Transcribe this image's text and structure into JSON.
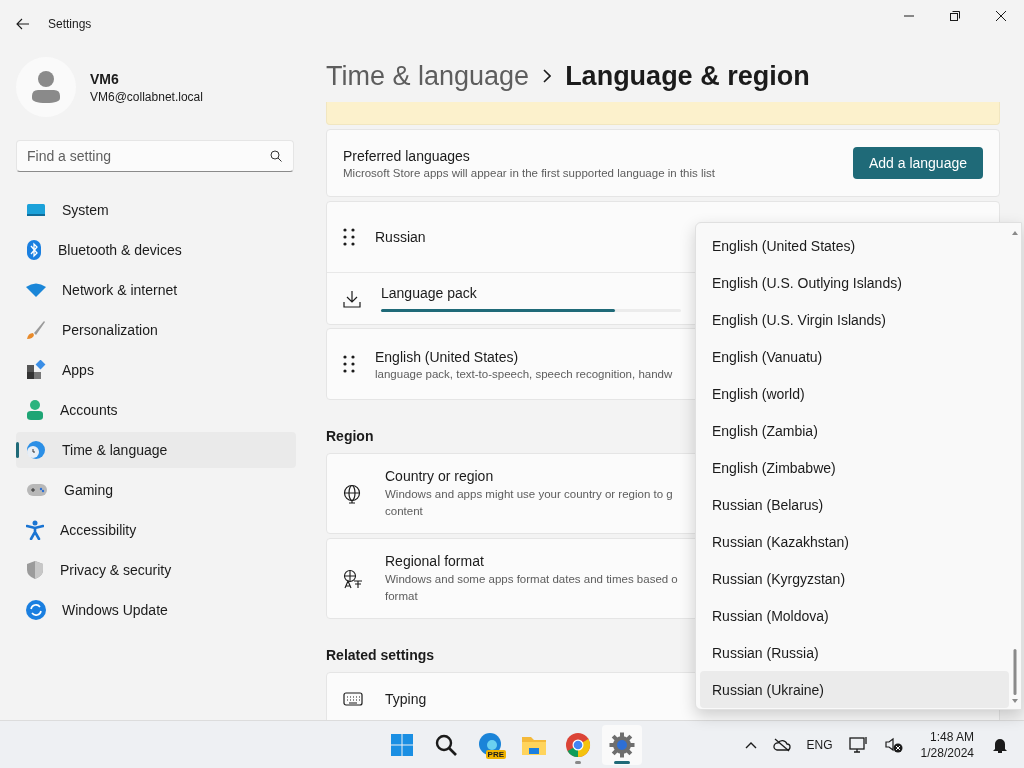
{
  "window": {
    "title": "Settings"
  },
  "account": {
    "name": "VM6",
    "email": "VM6@collabnet.local"
  },
  "search": {
    "placeholder": "Find a setting"
  },
  "sidebar": {
    "items": [
      {
        "label": "System",
        "selected": false
      },
      {
        "label": "Bluetooth & devices",
        "selected": false
      },
      {
        "label": "Network & internet",
        "selected": false
      },
      {
        "label": "Personalization",
        "selected": false
      },
      {
        "label": "Apps",
        "selected": false
      },
      {
        "label": "Accounts",
        "selected": false
      },
      {
        "label": "Time & language",
        "selected": true
      },
      {
        "label": "Gaming",
        "selected": false
      },
      {
        "label": "Accessibility",
        "selected": false
      },
      {
        "label": "Privacy & security",
        "selected": false
      },
      {
        "label": "Windows Update",
        "selected": false
      }
    ]
  },
  "breadcrumb": [
    "Time & language",
    "Language & region"
  ],
  "preferred": {
    "title": "Preferred languages",
    "description": "Microsoft Store apps will appear in the first supported language in this list",
    "button": "Add a language"
  },
  "languages": [
    {
      "kind": "drag",
      "title": "Russian"
    },
    {
      "kind": "download",
      "title": "Language pack",
      "level": 0.78
    },
    {
      "kind": "drag",
      "title": "English (United States)",
      "lines": [
        "language pack, text-to-speech, speech recognition, handw"
      ]
    }
  ],
  "region": {
    "heading": "Region",
    "items": [
      {
        "kind": "globe",
        "title": "Country or region",
        "lines": [
          "Windows and apps might use your country or region to g",
          "content"
        ]
      },
      {
        "kind": "format",
        "title": "Regional format",
        "lines": [
          "Windows and some apps format dates and times based o",
          "format"
        ]
      }
    ]
  },
  "related": {
    "heading": "Related settings",
    "items": [
      {
        "kind": "keyboard",
        "title": "Typing"
      }
    ]
  },
  "dropdown": {
    "items": [
      {
        "label": "English (United States)",
        "selected": false
      },
      {
        "label": "English (U.S. Outlying Islands)",
        "selected": false
      },
      {
        "label": "English (U.S. Virgin Islands)",
        "selected": false
      },
      {
        "label": "English (Vanuatu)",
        "selected": false
      },
      {
        "label": "English (world)",
        "selected": false
      },
      {
        "label": "English (Zambia)",
        "selected": false
      },
      {
        "label": "English (Zimbabwe)",
        "selected": false
      },
      {
        "label": "Russian (Belarus)",
        "selected": false
      },
      {
        "label": "Russian (Kazakhstan)",
        "selected": false
      },
      {
        "label": "Russian (Kyrgyzstan)",
        "selected": false
      },
      {
        "label": "Russian (Moldova)",
        "selected": false
      },
      {
        "label": "Russian (Russia)",
        "selected": false
      },
      {
        "label": "Russian (Ukraine)",
        "selected": true
      }
    ]
  },
  "taskbar": {
    "apps": [
      {
        "kind": "start",
        "selected": false,
        "running": false
      },
      {
        "kind": "search",
        "selected": false,
        "running": false
      },
      {
        "kind": "edge",
        "selected": false,
        "running": false,
        "badge": "PRE"
      },
      {
        "kind": "folder",
        "selected": false,
        "running": false
      },
      {
        "kind": "chrome",
        "selected": false,
        "running": true
      },
      {
        "kind": "settings",
        "selected": true,
        "running": true
      }
    ],
    "language": "ENG",
    "time": "1:48 AM",
    "date": "1/28/2024"
  }
}
